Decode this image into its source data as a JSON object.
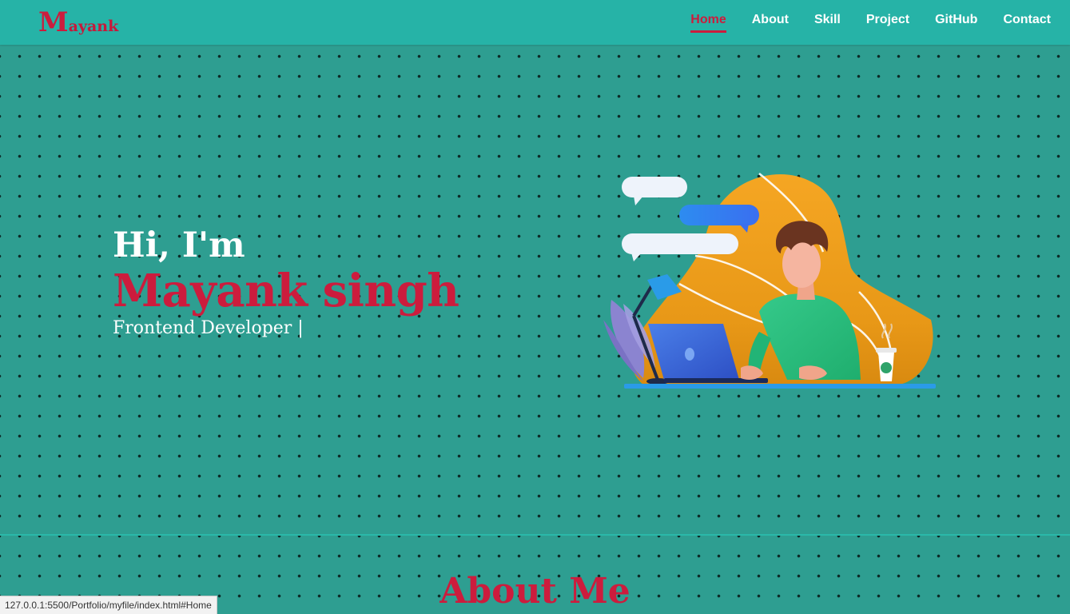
{
  "brand": {
    "initial": "M",
    "rest": "ayank"
  },
  "nav": {
    "items": [
      {
        "label": "Home",
        "active": true
      },
      {
        "label": "About",
        "active": false
      },
      {
        "label": "Skill",
        "active": false
      },
      {
        "label": "Project",
        "active": false
      },
      {
        "label": "GitHub",
        "active": false
      },
      {
        "label": "Contact",
        "active": false
      }
    ]
  },
  "hero": {
    "greeting": "Hi, I'm",
    "name": "Mayank singh",
    "role": "Frontend Developer |"
  },
  "about": {
    "title": "About Me"
  },
  "status_bar": {
    "url": "127.0.0.1:5500/Portfolio/myfile/index.html#Home"
  },
  "colors": {
    "accent": "#cc1c3d",
    "navbar": "#26b3a7",
    "background": "#2e9e91"
  },
  "icons": {
    "illustration": "developer-at-laptop-illustration"
  }
}
